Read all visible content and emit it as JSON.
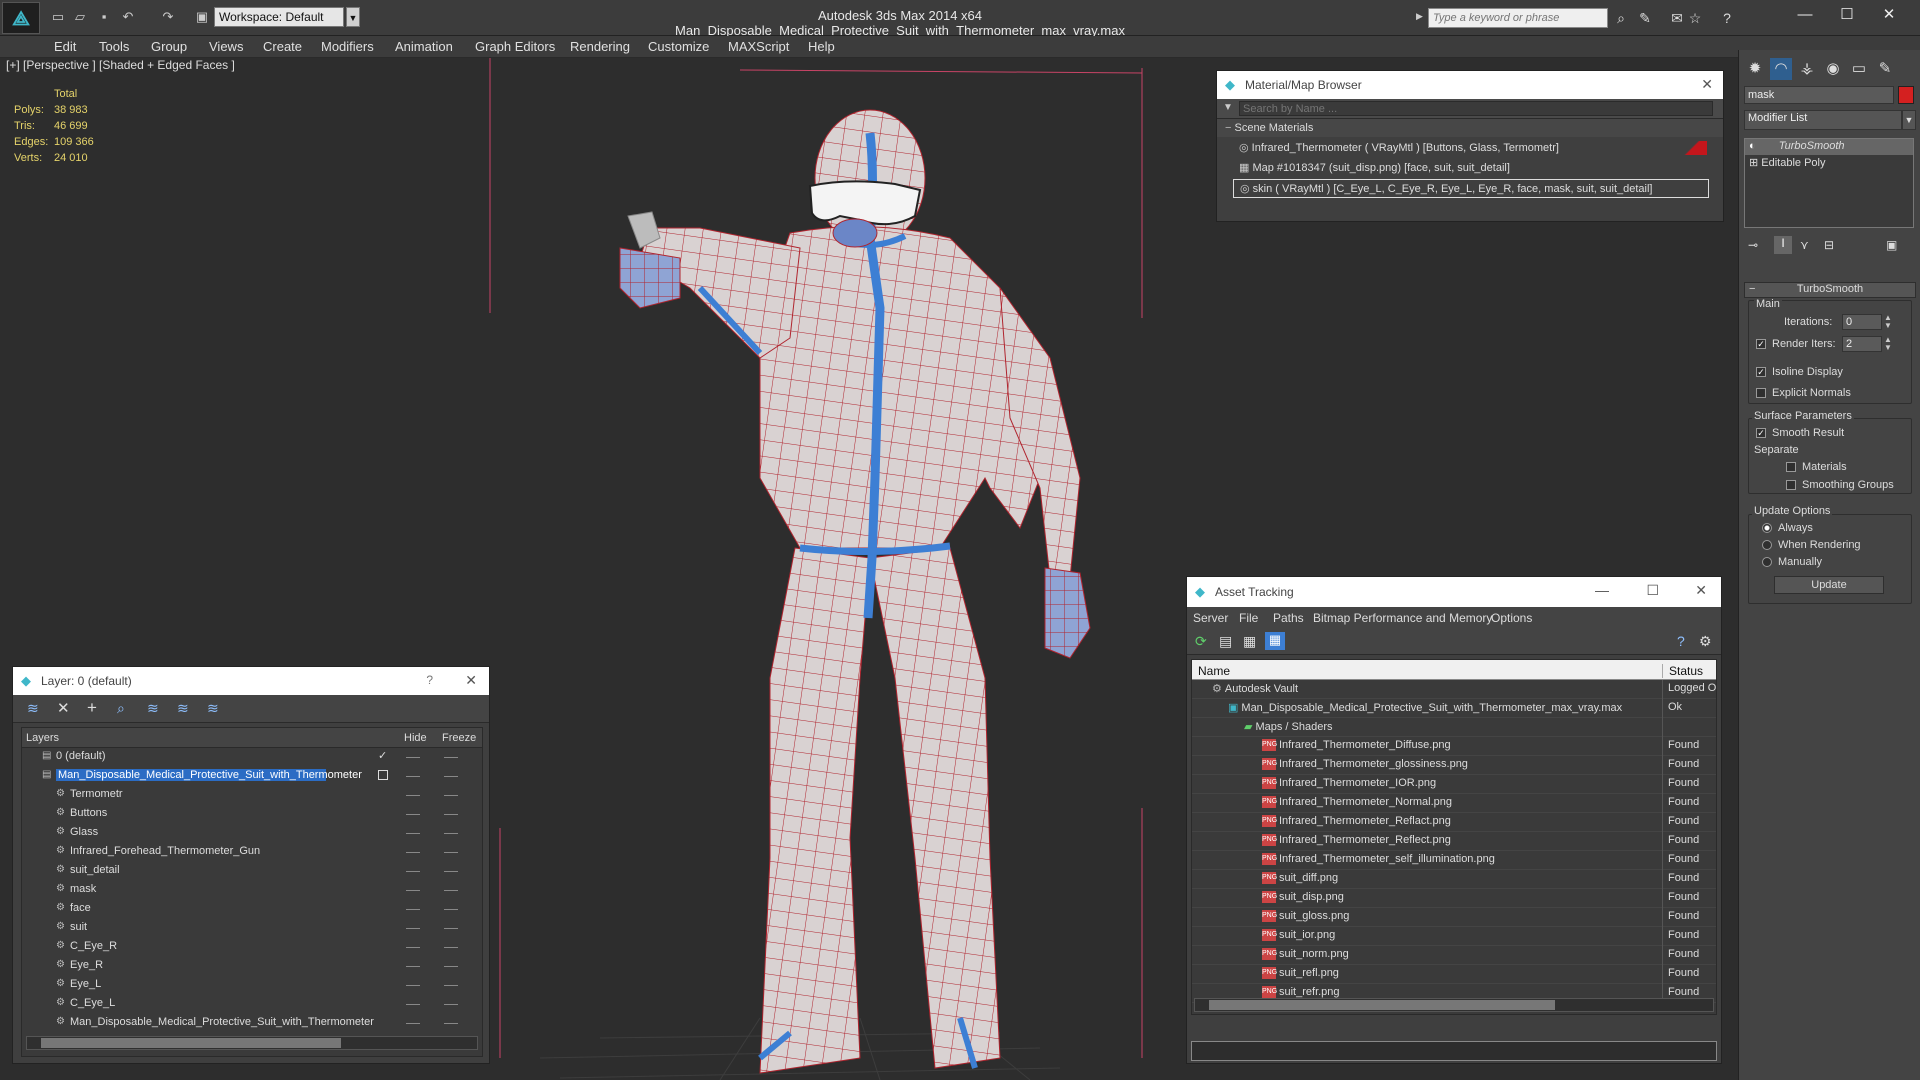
{
  "app": {
    "title": "Autodesk 3ds Max  2014 x64     Man_Disposable_Medical_Protective_Suit_with_Thermometer_max_vray.max",
    "workspace": "Workspace: Default",
    "search_placeholder": "Type a keyword or phrase"
  },
  "menu": [
    "Edit",
    "Tools",
    "Group",
    "Views",
    "Create",
    "Modifiers",
    "Animation",
    "Graph Editors",
    "Rendering",
    "Customize",
    "MAXScript",
    "Help"
  ],
  "viewport": {
    "label": "[+] [Perspective ] [Shaded + Edged Faces ]",
    "stats": {
      "header": "Total",
      "rows": [
        {
          "label": "Polys:",
          "value": "38 983"
        },
        {
          "label": "Tris:",
          "value": "46 699"
        },
        {
          "label": "Edges:",
          "value": "109 366"
        },
        {
          "label": "Verts:",
          "value": "24 010"
        }
      ]
    }
  },
  "material_browser": {
    "title": "Material/Map Browser",
    "search_placeholder": "Search by Name ...",
    "section": "Scene Materials",
    "items": [
      "Infrared_Thermometer  ( VRayMtl ) [Buttons, Glass, Termometr]",
      "Map #1018347 (suit_disp.png) [face, suit, suit_detail]",
      "skin  ( VRayMtl ) [C_Eye_L, C_Eye_R, Eye_L, Eye_R, face, mask, suit, suit_detail]"
    ]
  },
  "layers": {
    "title": "Layer: 0 (default)",
    "help": "?",
    "columns": {
      "name": "Layers",
      "hide": "Hide",
      "freeze": "Freeze"
    },
    "rows": [
      {
        "name": "0 (default)",
        "level": 1
      },
      {
        "name": "Man_Disposable_Medical_Protective_Suit_with_Thermometer",
        "level": 1
      },
      {
        "name": "Termometr",
        "level": 2
      },
      {
        "name": "Buttons",
        "level": 2
      },
      {
        "name": "Glass",
        "level": 2
      },
      {
        "name": "Infrared_Forehead_Thermometer_Gun",
        "level": 2
      },
      {
        "name": "suit_detail",
        "level": 2
      },
      {
        "name": "mask",
        "level": 2
      },
      {
        "name": "face",
        "level": 2
      },
      {
        "name": "suit",
        "level": 2
      },
      {
        "name": "C_Eye_R",
        "level": 2
      },
      {
        "name": "Eye_R",
        "level": 2
      },
      {
        "name": "Eye_L",
        "level": 2
      },
      {
        "name": "C_Eye_L",
        "level": 2
      },
      {
        "name": "Man_Disposable_Medical_Protective_Suit_with_Thermometer",
        "level": 2
      }
    ]
  },
  "asset_tracking": {
    "title": "Asset Tracking",
    "menu": [
      "Server",
      "File",
      "Paths",
      "Bitmap Performance and Memory",
      "Options"
    ],
    "columns": {
      "name": "Name",
      "status": "Status"
    },
    "rows": [
      {
        "name": "Autodesk Vault",
        "status": "Logged O",
        "level": 1,
        "kind": "vault"
      },
      {
        "name": "Man_Disposable_Medical_Protective_Suit_with_Thermometer_max_vray.max",
        "status": "Ok",
        "level": 2,
        "kind": "max"
      },
      {
        "name": "Maps / Shaders",
        "status": "",
        "level": 3,
        "kind": "maps"
      },
      {
        "name": "Infrared_Thermometer_Diffuse.png",
        "status": "Found",
        "level": 4,
        "kind": "png"
      },
      {
        "name": "Infrared_Thermometer_glossiness.png",
        "status": "Found",
        "level": 4,
        "kind": "png"
      },
      {
        "name": "Infrared_Thermometer_IOR.png",
        "status": "Found",
        "level": 4,
        "kind": "png"
      },
      {
        "name": "Infrared_Thermometer_Normal.png",
        "status": "Found",
        "level": 4,
        "kind": "png"
      },
      {
        "name": "Infrared_Thermometer_Reflact.png",
        "status": "Found",
        "level": 4,
        "kind": "png"
      },
      {
        "name": "Infrared_Thermometer_Reflect.png",
        "status": "Found",
        "level": 4,
        "kind": "png"
      },
      {
        "name": "Infrared_Thermometer_self_illumination.png",
        "status": "Found",
        "level": 4,
        "kind": "png"
      },
      {
        "name": "suit_diff.png",
        "status": "Found",
        "level": 4,
        "kind": "png"
      },
      {
        "name": "suit_disp.png",
        "status": "Found",
        "level": 4,
        "kind": "png"
      },
      {
        "name": "suit_gloss.png",
        "status": "Found",
        "level": 4,
        "kind": "png"
      },
      {
        "name": "suit_ior.png",
        "status": "Found",
        "level": 4,
        "kind": "png"
      },
      {
        "name": "suit_norm.png",
        "status": "Found",
        "level": 4,
        "kind": "png"
      },
      {
        "name": "suit_refl.png",
        "status": "Found",
        "level": 4,
        "kind": "png"
      },
      {
        "name": "suit_refr.png",
        "status": "Found",
        "level": 4,
        "kind": "png"
      }
    ]
  },
  "command_panel": {
    "name_field": "mask",
    "modifier_list": "Modifier List",
    "stack": [
      "TurboSmooth",
      "Editable Poly"
    ],
    "rollout_title": "TurboSmooth",
    "main_label": "Main",
    "iterations_label": "Iterations:",
    "iterations_value": "0",
    "render_iters_label": "Render Iters:",
    "render_iters_value": "2",
    "isoline": "Isoline Display",
    "explicit_normals": "Explicit Normals",
    "surface_params": "Surface Parameters",
    "smooth_result": "Smooth Result",
    "separate": "Separate",
    "materials": "Materials",
    "smoothing_groups": "Smoothing Groups",
    "update_options": "Update Options",
    "always": "Always",
    "when_rendering": "When Rendering",
    "manually": "Manually",
    "update_button": "Update"
  }
}
